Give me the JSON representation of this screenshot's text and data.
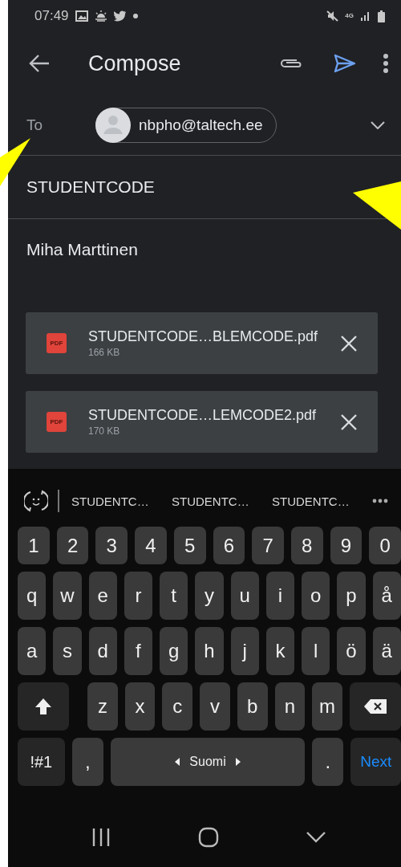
{
  "status_bar": {
    "time": "07:49",
    "network": "4G"
  },
  "app_bar": {
    "title": "Compose"
  },
  "to": {
    "label": "To",
    "recipients": [
      {
        "email": "nbpho@taltech.ee"
      }
    ]
  },
  "subject": "STUDENTCODE",
  "body": "Miha Marttinen",
  "attachments": [
    {
      "name": "STUDENTCODE…BLEMCODE.pdf",
      "size": "166 KB",
      "file_type": "PDF"
    },
    {
      "name": "STUDENTCODE…LEMCODE2.pdf",
      "size": "170 KB",
      "file_type": "PDF"
    }
  ],
  "keyboard": {
    "suggestions": [
      "STUDENTC…",
      "STUDENTC…",
      "STUDENTC…"
    ],
    "rows": [
      {
        "kind": "number",
        "keys": [
          {
            "kind": "char",
            "label": "1"
          },
          {
            "kind": "char",
            "label": "2"
          },
          {
            "kind": "char",
            "label": "3"
          },
          {
            "kind": "char",
            "label": "4"
          },
          {
            "kind": "char",
            "label": "5"
          },
          {
            "kind": "char",
            "label": "6"
          },
          {
            "kind": "char",
            "label": "7"
          },
          {
            "kind": "char",
            "label": "8"
          },
          {
            "kind": "char",
            "label": "9"
          },
          {
            "kind": "char",
            "label": "0"
          }
        ]
      },
      {
        "kind": "letter",
        "keys": [
          {
            "kind": "char",
            "label": "q"
          },
          {
            "kind": "char",
            "label": "w"
          },
          {
            "kind": "char",
            "label": "e"
          },
          {
            "kind": "char",
            "label": "r"
          },
          {
            "kind": "char",
            "label": "t"
          },
          {
            "kind": "char",
            "label": "y"
          },
          {
            "kind": "char",
            "label": "u"
          },
          {
            "kind": "char",
            "label": "i"
          },
          {
            "kind": "char",
            "label": "o"
          },
          {
            "kind": "char",
            "label": "p"
          },
          {
            "kind": "char",
            "label": "å"
          }
        ]
      },
      {
        "kind": "letter",
        "keys": [
          {
            "kind": "char",
            "label": "a"
          },
          {
            "kind": "char",
            "label": "s"
          },
          {
            "kind": "char",
            "label": "d"
          },
          {
            "kind": "char",
            "label": "f"
          },
          {
            "kind": "char",
            "label": "g"
          },
          {
            "kind": "char",
            "label": "h"
          },
          {
            "kind": "char",
            "label": "j"
          },
          {
            "kind": "char",
            "label": "k"
          },
          {
            "kind": "char",
            "label": "l"
          },
          {
            "kind": "char",
            "label": "ö"
          },
          {
            "kind": "char",
            "label": "ä"
          }
        ]
      },
      {
        "kind": "letter",
        "keys": [
          {
            "kind": "shift"
          },
          {
            "kind": "char",
            "label": "z"
          },
          {
            "kind": "char",
            "label": "x"
          },
          {
            "kind": "char",
            "label": "c"
          },
          {
            "kind": "char",
            "label": "v"
          },
          {
            "kind": "char",
            "label": "b"
          },
          {
            "kind": "char",
            "label": "n"
          },
          {
            "kind": "char",
            "label": "m"
          },
          {
            "kind": "backspace"
          }
        ]
      },
      {
        "kind": "letter",
        "keys": [
          {
            "kind": "symbols",
            "label": "!#1"
          },
          {
            "kind": "char",
            "label": ","
          },
          {
            "kind": "space",
            "label": "Suomi"
          },
          {
            "kind": "char",
            "label": "."
          },
          {
            "kind": "action",
            "label": "Next"
          }
        ]
      }
    ]
  }
}
